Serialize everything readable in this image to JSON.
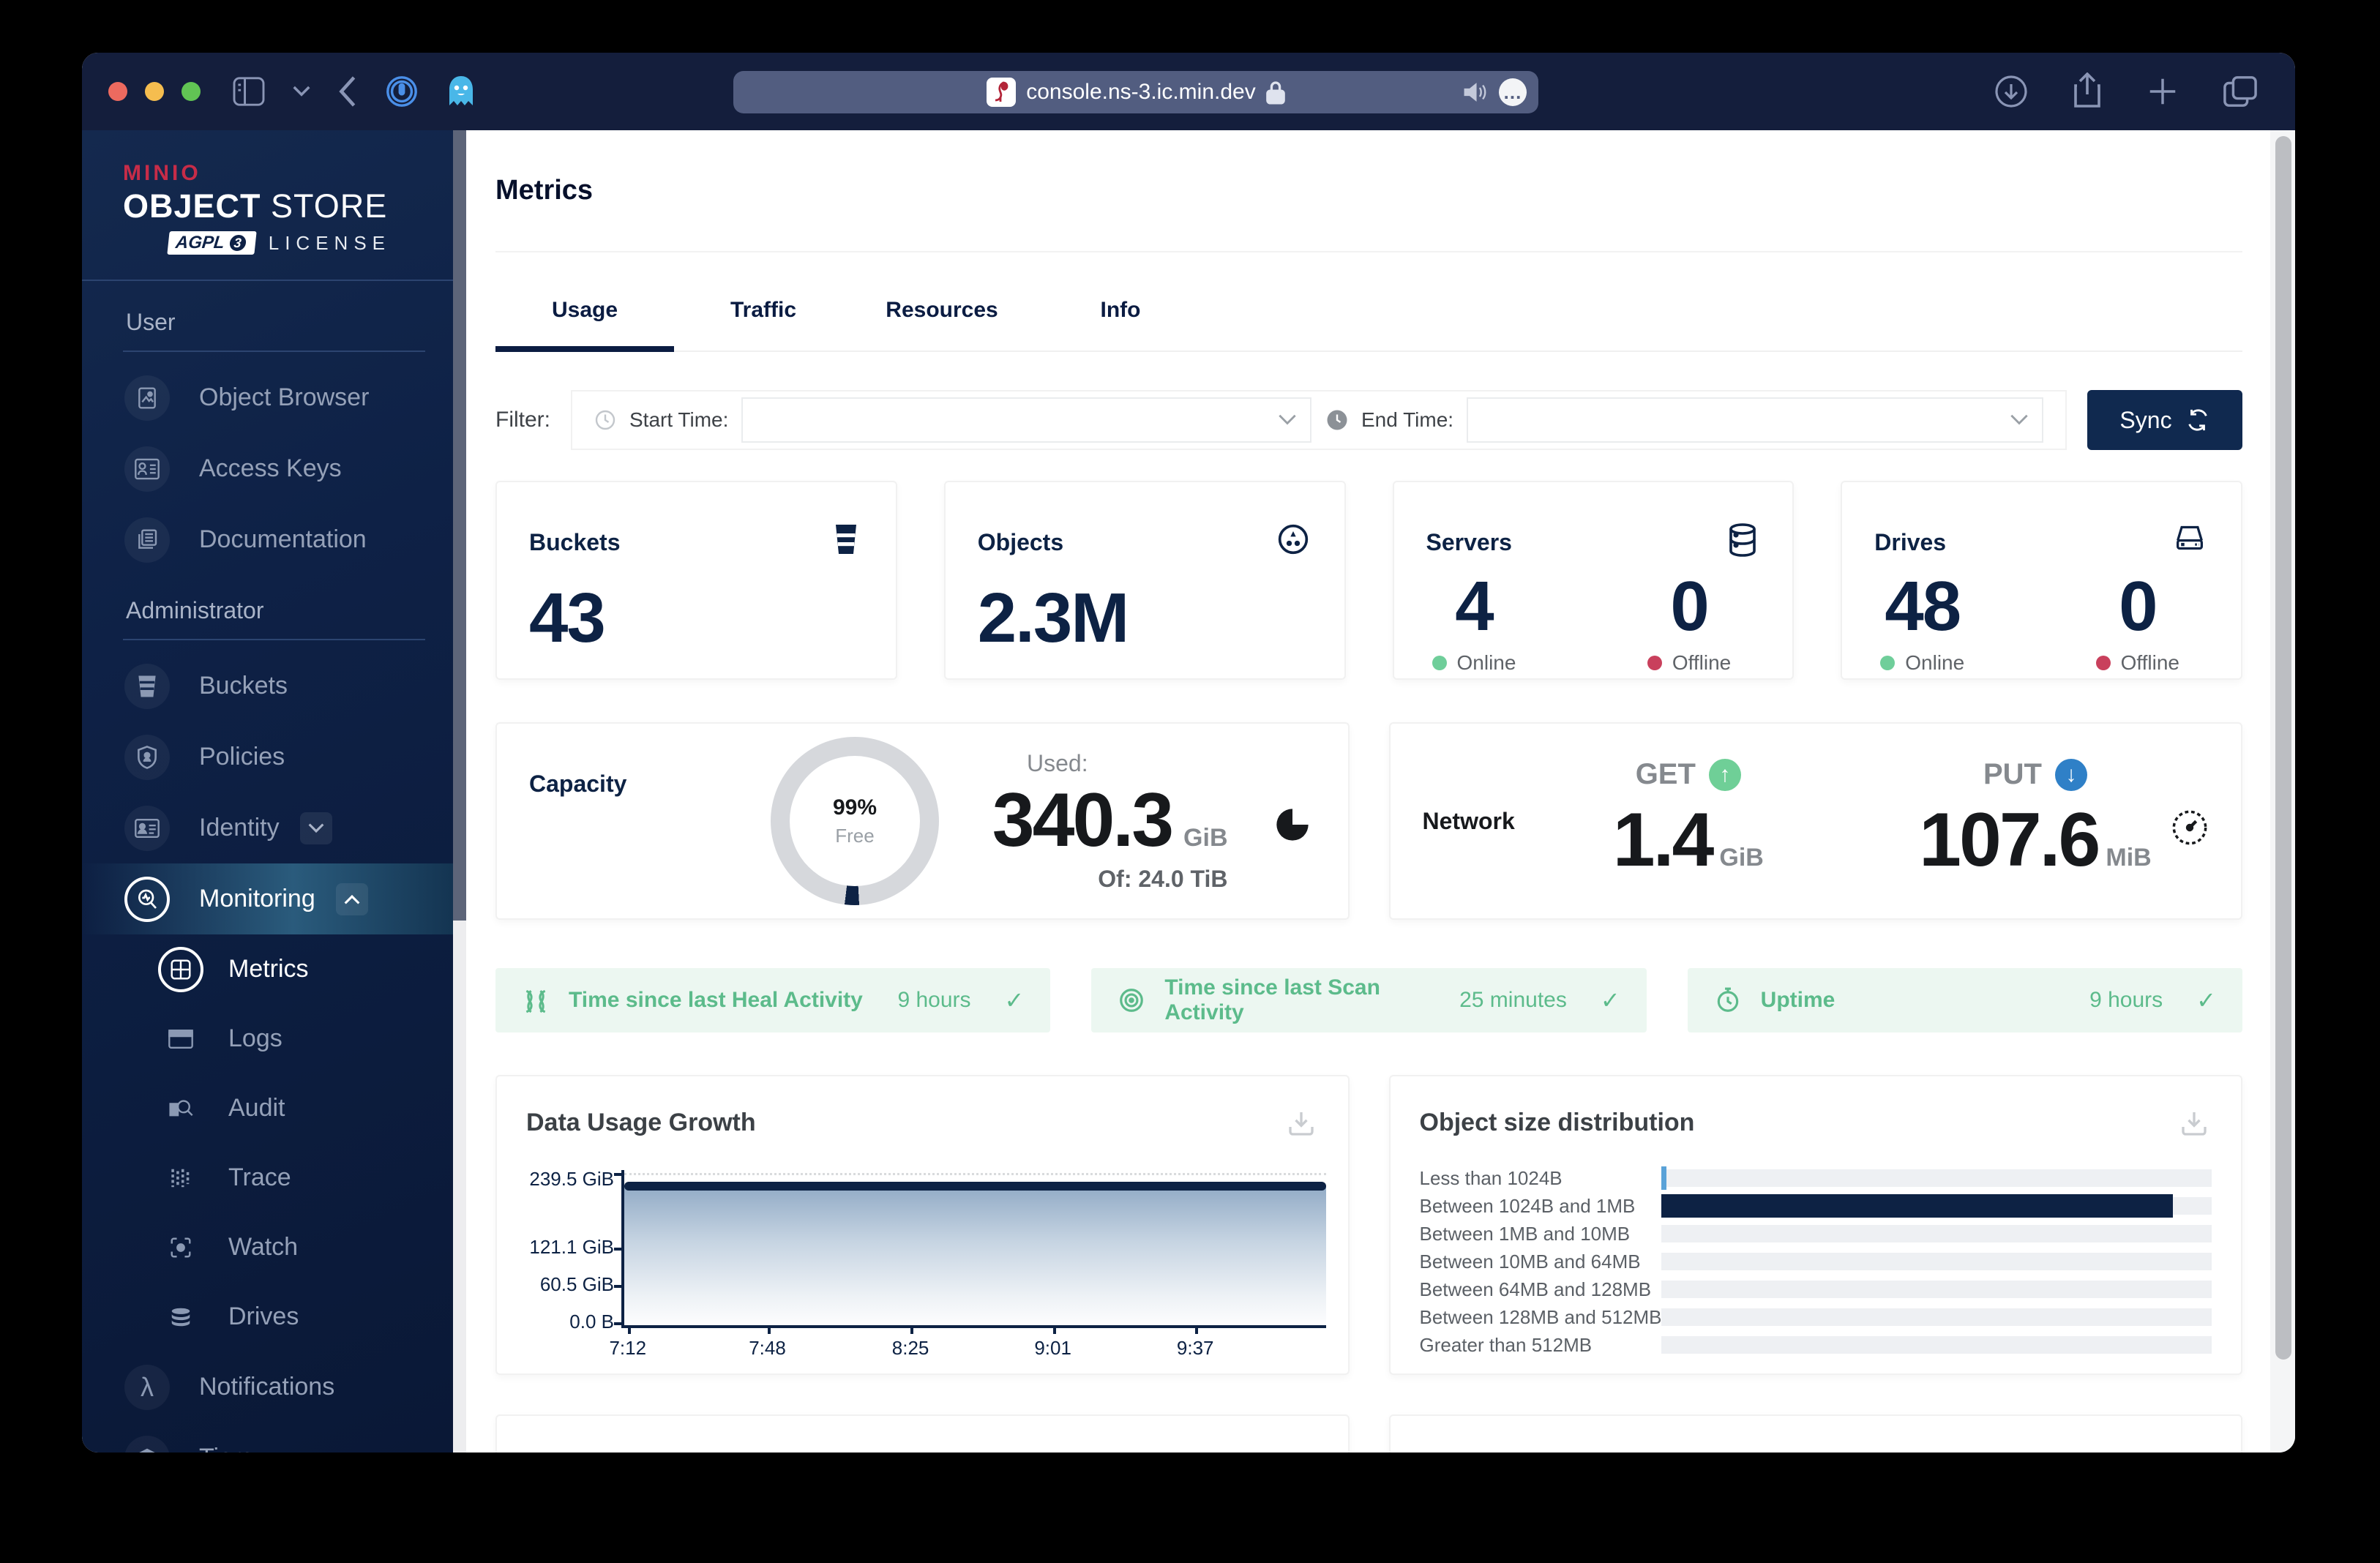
{
  "colors": {
    "navy": "#0d2244",
    "chrome": "#141e3c",
    "green": "#6fce9a",
    "red": "#c9405c",
    "status_green": "#5cbb8b",
    "get_green": "#6fcf97",
    "put_blue": "#2f80c7"
  },
  "browser": {
    "url": "console.ns-3.ic.min.dev"
  },
  "sidebar": {
    "brand": "MINIO",
    "logo_title_bold": "OBJECT",
    "logo_title_light": "STORE",
    "license_badge": "AGPL",
    "license_badge_version": "3",
    "license_label": "LICENSE",
    "section_user": "User",
    "section_admin": "Administrator",
    "items": {
      "object_browser": "Object Browser",
      "access_keys": "Access Keys",
      "documentation": "Documentation",
      "buckets": "Buckets",
      "policies": "Policies",
      "identity": "Identity",
      "monitoring": "Monitoring",
      "metrics": "Metrics",
      "logs": "Logs",
      "audit": "Audit",
      "trace": "Trace",
      "watch": "Watch",
      "drives": "Drives",
      "notifications": "Notifications",
      "tiers": "Tiers"
    }
  },
  "header": {
    "title": "Metrics"
  },
  "tabs": {
    "usage": "Usage",
    "traffic": "Traffic",
    "resources": "Resources",
    "info": "Info",
    "active": "Usage"
  },
  "filter": {
    "label": "Filter:",
    "start_label": "Start Time:",
    "start_value": "",
    "end_label": "End Time:",
    "end_value": "",
    "sync_label": "Sync"
  },
  "stats": {
    "buckets": {
      "label": "Buckets",
      "value": "43"
    },
    "objects": {
      "label": "Objects",
      "value": "2.3M"
    },
    "servers": {
      "label": "Servers",
      "online": "4",
      "offline": "0",
      "online_label": "Online",
      "offline_label": "Offline"
    },
    "drives": {
      "label": "Drives",
      "online": "48",
      "offline": "0",
      "online_label": "Online",
      "offline_label": "Offline"
    }
  },
  "capacity": {
    "title": "Capacity",
    "donut_pct": "99%",
    "donut_label": "Free",
    "used_label": "Used:",
    "used_value": "340.3",
    "used_unit": "GiB",
    "total_label": "Of: 24.0 TiB"
  },
  "network": {
    "title": "Network",
    "get_label": "GET",
    "get_arrow": "↑",
    "get_value": "1.4",
    "get_unit": "GiB",
    "put_label": "PUT",
    "put_arrow": "↓",
    "put_value": "107.6",
    "put_unit": "MiB"
  },
  "status_bars": [
    {
      "label": "Time since last Heal Activity",
      "value": "9 hours",
      "check": "✓"
    },
    {
      "label": "Time since last Scan Activity",
      "value": "25 minutes",
      "check": "✓"
    },
    {
      "label": "Uptime",
      "value": "9 hours",
      "check": "✓"
    }
  ],
  "chart_data": [
    {
      "type": "area",
      "title": "Data Usage Growth",
      "x": [
        "7:12",
        "7:48",
        "8:25",
        "9:01",
        "9:37"
      ],
      "series": [
        {
          "name": "Data Usage",
          "values": [
            220,
            220,
            220,
            220,
            220
          ]
        }
      ],
      "ylim": [
        0,
        245
      ],
      "ytick_labels": [
        "239.5 GiB",
        "121.1 GiB",
        "60.5 GiB",
        "0.0 B"
      ],
      "ytick_values": [
        239.5,
        121.1,
        60.5,
        0
      ],
      "grid": "dotted-horizontal",
      "line_color": "#0d2244",
      "fill": "blue-gradient",
      "legend": "none"
    },
    {
      "type": "bar",
      "title": "Object size distribution",
      "orientation": "horizontal",
      "categories": [
        "Less than 1024B",
        "Between 1024B and 1MB",
        "Between 1MB and 10MB",
        "Between 10MB and 64MB",
        "Between 64MB and 128MB",
        "Between 128MB and 512MB",
        "Greater than 512MB"
      ],
      "values_pct": [
        1,
        93,
        0,
        0,
        0,
        0,
        0
      ],
      "xlim": [
        0,
        100
      ],
      "bar_color": "#0d2244",
      "first_bar_color": "#5aa2d8",
      "legend": "none"
    }
  ]
}
